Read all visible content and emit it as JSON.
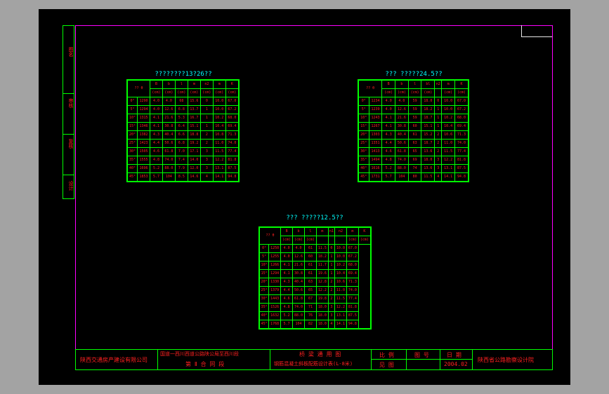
{
  "side_labels": [
    "图名",
    "审核",
    "复核",
    "设计"
  ],
  "tables": [
    {
      "title": "????????13?26??",
      "headers": [
        [
          "?? θ",
          "B",
          "b",
          "l",
          "m",
          "n2",
          "m",
          "K"
        ],
        [
          "",
          "(cm)",
          "(cm)",
          "(cm)",
          "(cm)",
          "(cm)",
          "(cm)",
          "(cm)"
        ]
      ],
      "rows": [
        [
          "0°",
          "1290",
          "4.0",
          "4.0",
          "68",
          "15.6",
          "0",
          "10.0",
          "67.0"
        ],
        [
          "5°",
          "1294",
          "4.0",
          "12.6",
          "6.8",
          "13.7",
          "1",
          "10.0",
          "67.2"
        ],
        [
          "10°",
          "1315",
          "4.1",
          "21.6",
          "5.3",
          "16.7",
          "1",
          "10.2",
          "68.0"
        ],
        [
          "15°",
          "1346",
          "4.1",
          "30.8",
          "6.4",
          "15.1",
          "1",
          "10.4",
          "69.4"
        ],
        [
          "20°",
          "1382",
          "4.3",
          "40.4",
          "6.6",
          "18.8",
          "2",
          "10.8",
          "71.3"
        ],
        [
          "25°",
          "1423",
          "4.4",
          "50.6",
          "6.8",
          "19.2",
          "2",
          "11.0",
          "74.0"
        ],
        [
          "30°",
          "1505",
          "4.6",
          "61.8",
          "7.0",
          "17.1",
          "3",
          "11.5",
          "77.4"
        ],
        [
          "35°",
          "1555",
          "4.8",
          "74.0",
          "7.4",
          "14.0",
          "3",
          "12.2",
          "81.8"
        ],
        [
          "40°",
          "1696",
          "5.2",
          "88.0",
          "7.9",
          "12.0",
          "3",
          "13.1",
          "87.5"
        ],
        [
          "45°",
          "1853",
          "5.7",
          "104",
          "8.5",
          "14.6",
          "4",
          "14.1",
          "94.8"
        ]
      ]
    },
    {
      "title": "??? ?????24.5??",
      "headers": [
        [
          "?? θ",
          "B",
          "b",
          "l",
          "bl",
          "n2",
          "m",
          "K"
        ],
        [
          "",
          "(cm)",
          "(cm)",
          "(cm)",
          "(cm)",
          "",
          "(cm)",
          "(cm)"
        ]
      ],
      "rows": [
        [
          "0°",
          "1234",
          "4.0",
          "4.0",
          "59",
          "18.0",
          "0",
          "10.0",
          "67.0"
        ],
        [
          "5°",
          "1239",
          "4.0",
          "12.6",
          "59",
          "18.2",
          "1",
          "10.0",
          "67.2"
        ],
        [
          "10°",
          "1243",
          "4.1",
          "21.6",
          "59",
          "18.7",
          "1",
          "10.2",
          "68.0"
        ],
        [
          "15°",
          "1267",
          "4.1",
          "30.8",
          "60",
          "15.1",
          "1",
          "10.4",
          "69.4"
        ],
        [
          "20°",
          "1303",
          "4.3",
          "40.4",
          "61",
          "15.2",
          "2",
          "10.6",
          "71.3"
        ],
        [
          "25°",
          "1351",
          "4.4",
          "50.6",
          "63",
          "18.7",
          "2",
          "11.0",
          "74.0"
        ],
        [
          "30°",
          "1413",
          "4.6",
          "61.8",
          "65",
          "13.6",
          "2",
          "11.5",
          "77.4"
        ],
        [
          "35°",
          "1494",
          "4.8",
          "74.0",
          "69",
          "18.0",
          "3",
          "12.2",
          "81.8"
        ],
        [
          "40°",
          "1616",
          "5.2",
          "88.0",
          "74",
          "13.6",
          "3",
          "13.1",
          "87.5"
        ],
        [
          "45°",
          "1731",
          "5.7",
          "104",
          "80",
          "11.5",
          "4",
          "14.1",
          "94.8"
        ]
      ]
    },
    {
      "title": "??? ?????12.5??",
      "headers": [
        [
          "?? θ",
          "B",
          "b",
          "l",
          "m",
          "n1",
          "n2",
          "m",
          "K"
        ],
        [
          "",
          "(cm)",
          "(cm)",
          "(cm)",
          "",
          "",
          "",
          "(cm)",
          "(cm)"
        ]
      ],
      "rows": [
        [
          "0°",
          "1250",
          "4.0",
          "4.0",
          "61",
          "11.5",
          "0",
          "10.0",
          "67.0"
        ],
        [
          "5°",
          "1255",
          "4.0",
          "12.6",
          "60",
          "18.2",
          "1",
          "10.0",
          "67.2"
        ],
        [
          "10°",
          "1266",
          "4.1",
          "21.6",
          "61",
          "11.7",
          "1",
          "10.2",
          "68.0"
        ],
        [
          "15°",
          "1294",
          "4.1",
          "30.8",
          "61",
          "19.6",
          "1",
          "10.4",
          "69.4"
        ],
        [
          "20°",
          "1330",
          "4.3",
          "40.4",
          "63",
          "12.8",
          "2",
          "10.6",
          "71.3"
        ],
        [
          "25°",
          "1379",
          "4.4",
          "50.6",
          "65",
          "12.2",
          "2",
          "11.0",
          "74.0"
        ],
        [
          "30°",
          "1443",
          "4.6",
          "61.8",
          "67",
          "19.8",
          "2",
          "11.5",
          "77.4"
        ],
        [
          "35°",
          "1526",
          "4.8",
          "74.0",
          "71",
          "18.0",
          "3",
          "12.2",
          "81.8"
        ],
        [
          "40°",
          "1632",
          "5.2",
          "88.0",
          "76",
          "18.0",
          "3",
          "13.1",
          "87.5"
        ],
        [
          "45°",
          "1768",
          "5.7",
          "104",
          "82",
          "18.0",
          "4",
          "14.1",
          "94.8"
        ]
      ]
    }
  ],
  "title_block": {
    "company": "陕西交通房产建设有限公司",
    "project_line1": "国道一西川西道公路陕公局至西川段",
    "project_line2": "第 Ⅱ 合 同 段",
    "drawing_line1": "桥 梁 通 用 图",
    "drawing_line2": "钢筋混凝土斜板配筋设计表(L-8米)",
    "scale_label": "比 例",
    "scale_value": "见 图",
    "drawing_no_label": "图 号",
    "date_label": "日 期",
    "date_value": "2004.02",
    "institute": "陕西省公路勘察设计院"
  }
}
